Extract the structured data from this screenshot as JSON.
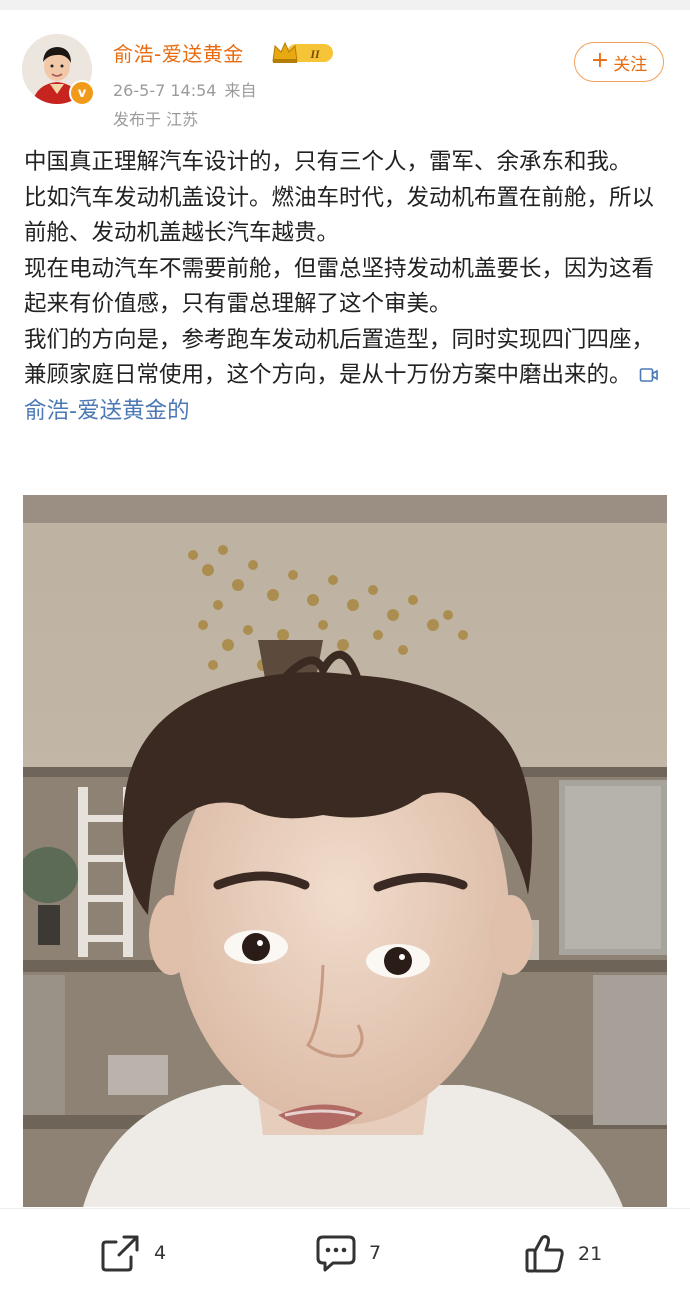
{
  "post": {
    "author": {
      "name": "俞浩-爱送黄金",
      "level_badge": "II",
      "verified_mark": "v",
      "name_color": "#e86b0f"
    },
    "meta": {
      "time": "26-5-7 14:54",
      "source_prefix": "来自",
      "location": "发布于 江苏"
    },
    "follow_button": {
      "plus": "+",
      "label": "关注"
    },
    "paragraphs": [
      "中国真正理解汽车设计的，只有三个人，雷军、余承东和我。",
      "比如汽车发动机盖设计。燃油车时代，发动机布置在前舱，所以前舱、发动机盖越长汽车越贵。",
      "现在电动汽车不需要前舱，但雷总坚持发动机盖要长，因为这看起来有价值感，只有雷总理解了这个审美。",
      "我们的方向是，参考跑车发动机后置造型，同时实现四门四座，兼顾家庭日常使用，这个方向，是从十万份方案中磨出来的。"
    ],
    "video_link": "俞浩-爱送黄金的",
    "link_color": "#4c79b5"
  },
  "actions": {
    "share_count": "4",
    "comment_count": "7",
    "like_count": "21"
  },
  "icons": {
    "share": "share-icon",
    "comment": "comment-icon",
    "like": "thumbs-up-icon",
    "video": "video-icon",
    "crown": "crown-badge-icon"
  }
}
